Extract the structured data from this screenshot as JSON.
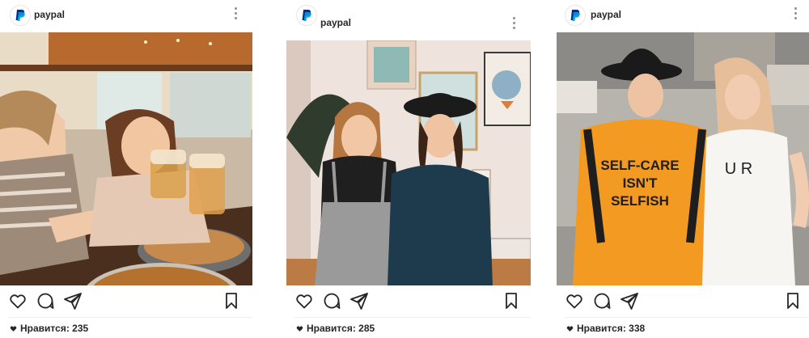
{
  "posts": [
    {
      "username": "paypal",
      "likes_label": "Нравится:",
      "likes_count": "235"
    },
    {
      "username": "paypal",
      "likes_label": "Нравится:",
      "likes_count": "285"
    },
    {
      "username": "paypal",
      "likes_label": "Нравится:",
      "likes_count": "338"
    }
  ],
  "photo3": {
    "shirt_line1": "SELF-CARE",
    "shirt_line2": "ISN'T",
    "shirt_line3": "SELFISH",
    "tank_text": "U R"
  },
  "colors": {
    "paypal_dark": "#003087",
    "paypal_light": "#009cde",
    "text": "#262626",
    "icon": "#262626"
  },
  "icons": [
    "paypal-logo-icon",
    "more-options-icon",
    "heart-icon",
    "comment-icon",
    "share-icon",
    "bookmark-icon"
  ]
}
